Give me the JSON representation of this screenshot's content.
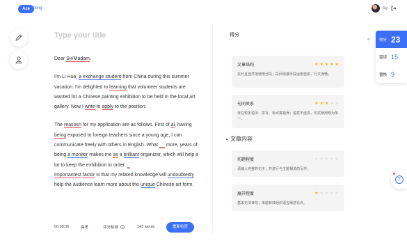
{
  "header": {
    "logo_badge": "Ace",
    "logo_text": "Writing",
    "user_name": "Gg",
    "logout_icon": "logout-icon"
  },
  "tools": [
    {
      "icon": "pencil-icon"
    },
    {
      "icon": "user-icon"
    }
  ],
  "editor": {
    "title_placeholder": "Type your title",
    "essay": {
      "greeting": "Dear Sir/Madam,",
      "p1": {
        "t1": "I'm Li Hua, ",
        "u1": "a exchange student",
        "t2": " from China during this summer vacation. I'm delighted to ",
        "u2": "learning",
        "t3": " that volunteer students are wanted for a Chinese painting exhibition to be held in the local art gallery. Now I ",
        "u3": "write",
        "t4": " to ",
        "u4": "apply",
        "t5": " to the position."
      },
      "p2": {
        "t1": "The ",
        "u1": "reasosn",
        "t2": " for my application are as follows. First of ",
        "u2": "al",
        "t3": ", having ",
        "u3": "being",
        "t4": " exposed to foreign teachers since a young age, I can communicate freely with others in English. What ",
        "g1": "__",
        "t5": " more, years of being ",
        "u4": "a monitor",
        "t6": " makes me ",
        "u5": "as",
        "t7": " a ",
        "u6": "brilliant",
        "t8": " organizer, which will help a lot to keep the exhibition in order. ",
        "g2": "_",
        "u7": "Importantest",
        "t9": " ",
        "u8": "factor",
        "t10": " is that my related knowledge will ",
        "u9": "undoubtedly",
        "t11": " help the audience learn more about the ",
        "u10": "unique",
        "t12": " Chinese art form."
      }
    },
    "footer": {
      "timer": "00:00:06",
      "exam": "高考",
      "criteria_label": "评分标准",
      "criteria_icon": "?",
      "word_count": "143 words",
      "rescore_label": "重新检查"
    }
  },
  "score_panel": {
    "title": "得分",
    "cards": [
      {
        "name": "文章结构",
        "stars": 5,
        "max_stars": 5,
        "desc": "充分且自然地使用分段；段间衔接手段运用自如，行文流畅。"
      },
      {
        "name": "句间关系",
        "stars": 3,
        "max_stars": 5,
        "desc": "存在较多语法、拼写、标点等错误；语意不连贯，句式使用较为单一。"
      }
    ],
    "content_section_title": "文章内容",
    "content_cards": [
      {
        "name": "切题程度",
        "stars": 0,
        "max_stars": 5,
        "desc": "请输入完整的句子，并进行与主题相关的写作。"
      },
      {
        "name": "展开程度",
        "stars": 1,
        "max_stars": 5,
        "desc": "基本无法读句；未能有效组织语言阐述论点。"
      }
    ]
  },
  "score_widget": {
    "collapse_icon": "«",
    "rows": [
      {
        "label": "得分",
        "value": "23"
      },
      {
        "label": "错误",
        "value": "15"
      },
      {
        "label": "替换",
        "value": "9"
      }
    ]
  },
  "help_float": {
    "icon": "?"
  },
  "colors": {
    "accent": "#3b6ff5",
    "error_underline": "#e05656",
    "suggest_underline": "#4a7bf0",
    "star_on": "#f5b301"
  }
}
